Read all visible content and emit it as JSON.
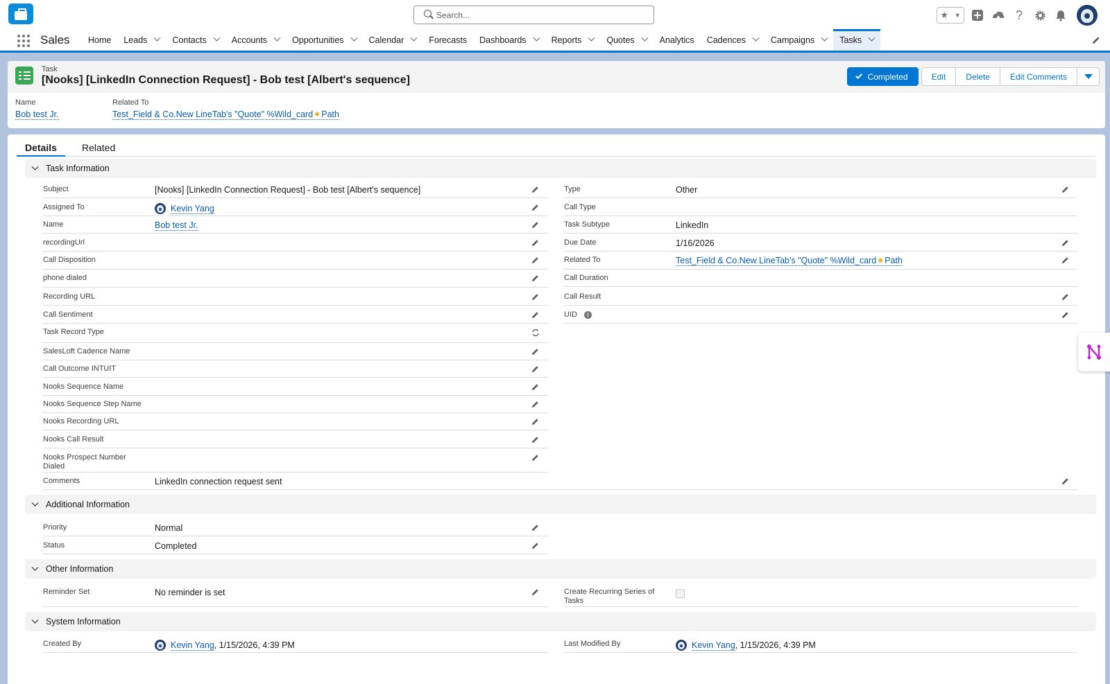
{
  "header": {
    "search_placeholder": "Search...",
    "icons": [
      "favorites-star-icon",
      "add-icon",
      "trailhead-icon",
      "help-icon",
      "setup-gear-icon",
      "notifications-bell-icon",
      "user-avatar"
    ]
  },
  "nav": {
    "app_name": "Sales",
    "items": [
      {
        "label": "Home",
        "dropdown": false
      },
      {
        "label": "Leads",
        "dropdown": true
      },
      {
        "label": "Contacts",
        "dropdown": true
      },
      {
        "label": "Accounts",
        "dropdown": true
      },
      {
        "label": "Opportunities",
        "dropdown": true
      },
      {
        "label": "Calendar",
        "dropdown": true
      },
      {
        "label": "Forecasts",
        "dropdown": false
      },
      {
        "label": "Dashboards",
        "dropdown": true
      },
      {
        "label": "Reports",
        "dropdown": true
      },
      {
        "label": "Quotes",
        "dropdown": true
      },
      {
        "label": "Analytics",
        "dropdown": false
      },
      {
        "label": "Cadences",
        "dropdown": true
      },
      {
        "label": "Campaigns",
        "dropdown": true
      },
      {
        "label": "Tasks",
        "dropdown": true,
        "active": true
      }
    ]
  },
  "record": {
    "object_label": "Task",
    "title": "[Nooks] [LinkedIn Connection Request] - Bob test [Albert's sequence]",
    "actions": {
      "completed": "Completed",
      "edit": "Edit",
      "delete": "Delete",
      "edit_comments": "Edit Comments"
    },
    "highlights": {
      "name_label": "Name",
      "name_value": "Bob test Jr.",
      "related_label": "Related To",
      "related_before": "Test_Field & Co.New LineTab's \"Quote\" %Wild_card",
      "related_after": "Path"
    }
  },
  "tabs": {
    "details": "Details",
    "related": "Related"
  },
  "sections": {
    "task_info": {
      "title": "Task Information",
      "left": [
        {
          "label": "Subject",
          "value": "[Nooks] [LinkedIn Connection Request] - Bob test [Albert's sequence]"
        },
        {
          "label": "Assigned To",
          "value": "Kevin Yang"
        },
        {
          "label": "Name",
          "value": "Bob test Jr."
        },
        {
          "label": "recordingUrl",
          "value": ""
        },
        {
          "label": "Call Disposition",
          "value": ""
        },
        {
          "label": "phone dialed",
          "value": ""
        },
        {
          "label": "Recording URL",
          "value": ""
        },
        {
          "label": "Call Sentiment",
          "value": ""
        },
        {
          "label": "Task Record Type",
          "value": ""
        },
        {
          "label": "SalesLoft Cadence Name",
          "value": ""
        },
        {
          "label": "Call Outcome INTUIT",
          "value": ""
        },
        {
          "label": "Nooks Sequence Name",
          "value": ""
        },
        {
          "label": "Nooks Sequence Step Name",
          "value": ""
        },
        {
          "label": "Nooks Recording URL",
          "value": ""
        },
        {
          "label": "Nooks Call Result",
          "value": ""
        },
        {
          "label": "Nooks Prospect Number Dialed",
          "value": ""
        }
      ],
      "right": [
        {
          "label": "Type",
          "value": "Other"
        },
        {
          "label": "Call Type",
          "value": ""
        },
        {
          "label": "Task Subtype",
          "value": "LinkedIn"
        },
        {
          "label": "Due Date",
          "value": "1/16/2026"
        },
        {
          "label": "Related To",
          "value_before": "Test_Field & Co.New LineTab's \"Quote\" %Wild_card",
          "value_after": "Path"
        },
        {
          "label": "Call Duration",
          "value": ""
        },
        {
          "label": "Call Result",
          "value": ""
        },
        {
          "label": "UID",
          "value": ""
        }
      ],
      "comments": {
        "label": "Comments",
        "value": "LinkedIn connection request sent"
      }
    },
    "additional_info": {
      "title": "Additional Information",
      "priority": {
        "label": "Priority",
        "value": "Normal"
      },
      "status": {
        "label": "Status",
        "value": "Completed"
      }
    },
    "other_info": {
      "title": "Other Information",
      "reminder": {
        "label": "Reminder Set",
        "value": "No reminder is set"
      },
      "recurring": {
        "label": "Create Recurring Series of Tasks",
        "checked": false
      }
    },
    "system_info": {
      "title": "System Information",
      "created": {
        "label": "Created By",
        "user": "Kevin Yang",
        "date": ", 1/15/2026, 4:39 PM"
      },
      "modified": {
        "label": "Last Modified By",
        "user": "Kevin Yang",
        "date": ", 1/15/2026, 4:39 PM"
      }
    }
  },
  "colors": {
    "brand": "#0176d3",
    "link": "#0b5cab",
    "task_icon": "#3ba755",
    "background": "#b0c4df"
  }
}
